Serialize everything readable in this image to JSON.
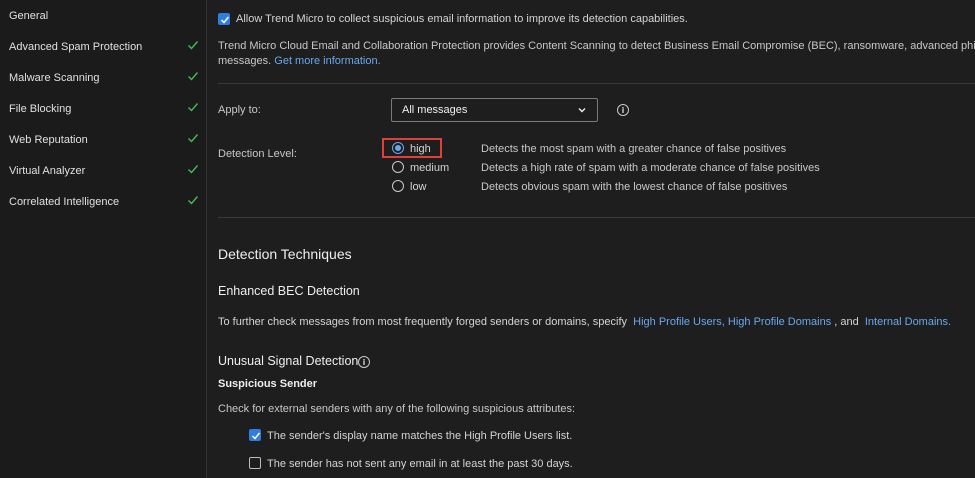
{
  "sidebar": {
    "items": [
      {
        "label": "General",
        "checked": false
      },
      {
        "label": "Advanced Spam Protection",
        "checked": true
      },
      {
        "label": "Malware Scanning",
        "checked": true
      },
      {
        "label": "File Blocking",
        "checked": true
      },
      {
        "label": "Web Reputation",
        "checked": true
      },
      {
        "label": "Virtual Analyzer",
        "checked": true
      },
      {
        "label": "Correlated Intelligence",
        "checked": true
      }
    ]
  },
  "main": {
    "collect_label": "Allow Trend Micro to collect suspicious email information to improve its detection capabilities.",
    "description": "Trend Micro Cloud Email and Collaboration Protection provides Content Scanning to detect Business Email Compromise (BEC), ransomware, advanced phishing,",
    "description_line2": "messages.",
    "more_info_link": "Get more information.",
    "apply_to_label": "Apply to:",
    "apply_to_value": "All messages",
    "detection_level_label": "Detection Level:",
    "levels": [
      {
        "name": "high",
        "desc": "Detects the most spam with a greater chance of false positives",
        "selected": true
      },
      {
        "name": "medium",
        "desc": "Detects a high rate of spam with a moderate chance of false positives",
        "selected": false
      },
      {
        "name": "low",
        "desc": "Detects obvious spam with the lowest chance of false positives",
        "selected": false
      }
    ],
    "techniques_title": "Detection Techniques",
    "bec_title": "Enhanced BEC Detection",
    "bec_text": "To further check messages from most frequently forged senders or domains, specify",
    "bec_link1": "High Profile Users, High Profile Domains",
    "bec_and": ", and",
    "bec_link2": "Internal Domains.",
    "unusual_title": "Unusual Signal Detection",
    "suspicious_title": "Suspicious Sender",
    "suspicious_text": "Check for external senders with any of the following suspicious attributes:",
    "sender_options": [
      {
        "label": "The sender's display name matches the High Profile Users list.",
        "checked": true
      },
      {
        "label": "The sender has not sent any email in at least the past 30 days.",
        "checked": false
      }
    ]
  },
  "colors": {
    "accent": "#2f7de1",
    "link": "#6aa7ef",
    "highlight": "#e0403a",
    "check": "#3fbf4f"
  },
  "icons": {
    "info": "info-circle-icon",
    "check": "checkmark-icon",
    "chevron": "chevron-down-icon"
  }
}
